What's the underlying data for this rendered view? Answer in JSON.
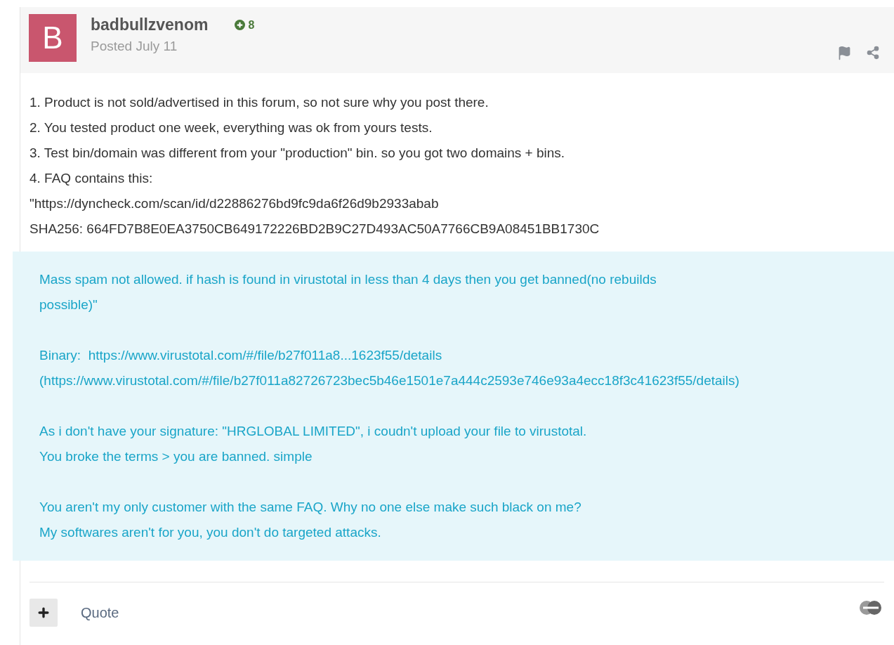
{
  "post": {
    "avatar_letter": "B",
    "author": "badbullzvenom",
    "reputation": "8",
    "date": "Posted July 11"
  },
  "body_lines": [
    "1. Product is not sold/advertised in this forum, so not sure why you post there.",
    "2. You tested product one week, everything was ok from yours tests.",
    "3. Test bin/domain was different from your \"production\" bin. so you got two domains + bins.",
    "4. FAQ contains this:",
    "\"https://dyncheck.com/scan/id/d22886276bd9fc9da6f26d9b2933abab",
    "SHA256: 664FD7B8E0EA3750CB649172226BD2B9C27D493AC50A7766CB9A08451BB1730C"
  ],
  "quote_paragraphs": [
    [
      "Mass spam not allowed. if hash is found in virustotal in less than 4 days then you get banned(no rebuilds",
      "possible)\""
    ],
    [
      "Binary:  https://www.virustotal.com/#/file/b27f011a8...1623f55/details",
      "(https://www.virustotal.com/#/file/b27f011a82726723bec5b46e1501e7a444c2593e746e93a4ecc18f3c41623f55/details)"
    ],
    [
      "As i don't have your signature: \"HRGLOBAL LIMITED\", i coudn't upload your file to virustotal.",
      "You broke the terms > you are banned. simple"
    ],
    [
      "You aren't my only customer with the same FAQ. Why no one else make such black on me?",
      "My softwares aren't for you, you don't do targeted attacks."
    ]
  ],
  "footer": {
    "quote_label": "Quote"
  }
}
